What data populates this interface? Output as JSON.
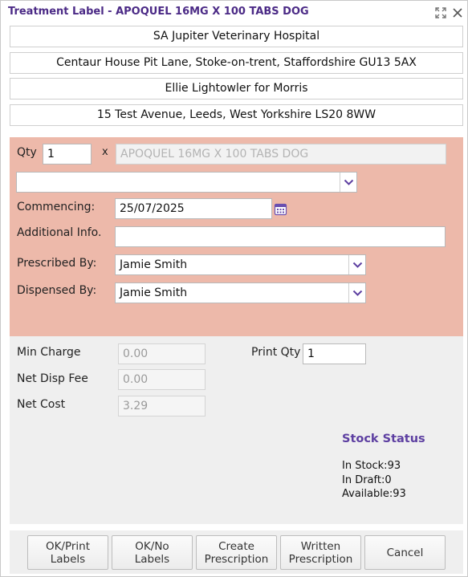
{
  "window": {
    "title": "Treatment Label - APOQUEL 16MG X 100 TABS DOG",
    "maximize_icon": "expand-arrows-icon",
    "close_icon": "close-x-icon"
  },
  "header": {
    "practice_name": "SA Jupiter Veterinary Hospital",
    "practice_address": "Centaur House Pit Lane, Stoke-on-trent, Staffordshire GU13 5AX",
    "client_pet": "Ellie Lightowler for Morris",
    "client_address": "15 Test Avenue, Leeds, West Yorkshire LS20 8WW"
  },
  "form": {
    "qty_label": "Qty",
    "qty_value": "1",
    "times_symbol": "x",
    "product_value": "APOQUEL 16MG X 100 TABS DOG",
    "dosage_value": "",
    "commencing_label": "Commencing:",
    "commencing_value": "25/07/2025",
    "additional_info_label": "Additional Info.",
    "additional_info_value": "",
    "prescribed_by_label": "Prescribed By:",
    "prescribed_by_value": "Jamie Smith",
    "dispensed_by_label": "Dispensed By:",
    "dispensed_by_value": "Jamie Smith"
  },
  "charges": {
    "min_charge_label": "Min Charge",
    "min_charge_value": "0.00",
    "net_disp_fee_label": "Net Disp Fee",
    "net_disp_fee_value": "0.00",
    "net_cost_label": "Net Cost",
    "net_cost_value": "3.29",
    "print_qty_label": "Print Qty",
    "print_qty_value": "1"
  },
  "stock": {
    "title": "Stock Status",
    "in_stock": "In Stock:93",
    "in_draft": "In Draft:0",
    "available": "Available:93"
  },
  "buttons": {
    "ok_print_line1": "OK/Print",
    "ok_print_line2": "Labels",
    "ok_no_line1": "OK/No",
    "ok_no_line2": "Labels",
    "create_line1": "Create",
    "create_line2": "Prescription",
    "written_line1": "Written",
    "written_line2": "Prescription",
    "cancel": "Cancel"
  },
  "colors": {
    "title_text": "#4b2a86",
    "form_background": "#edb9aa",
    "panel_background": "#efefef",
    "accent": "#5d3fa1"
  }
}
